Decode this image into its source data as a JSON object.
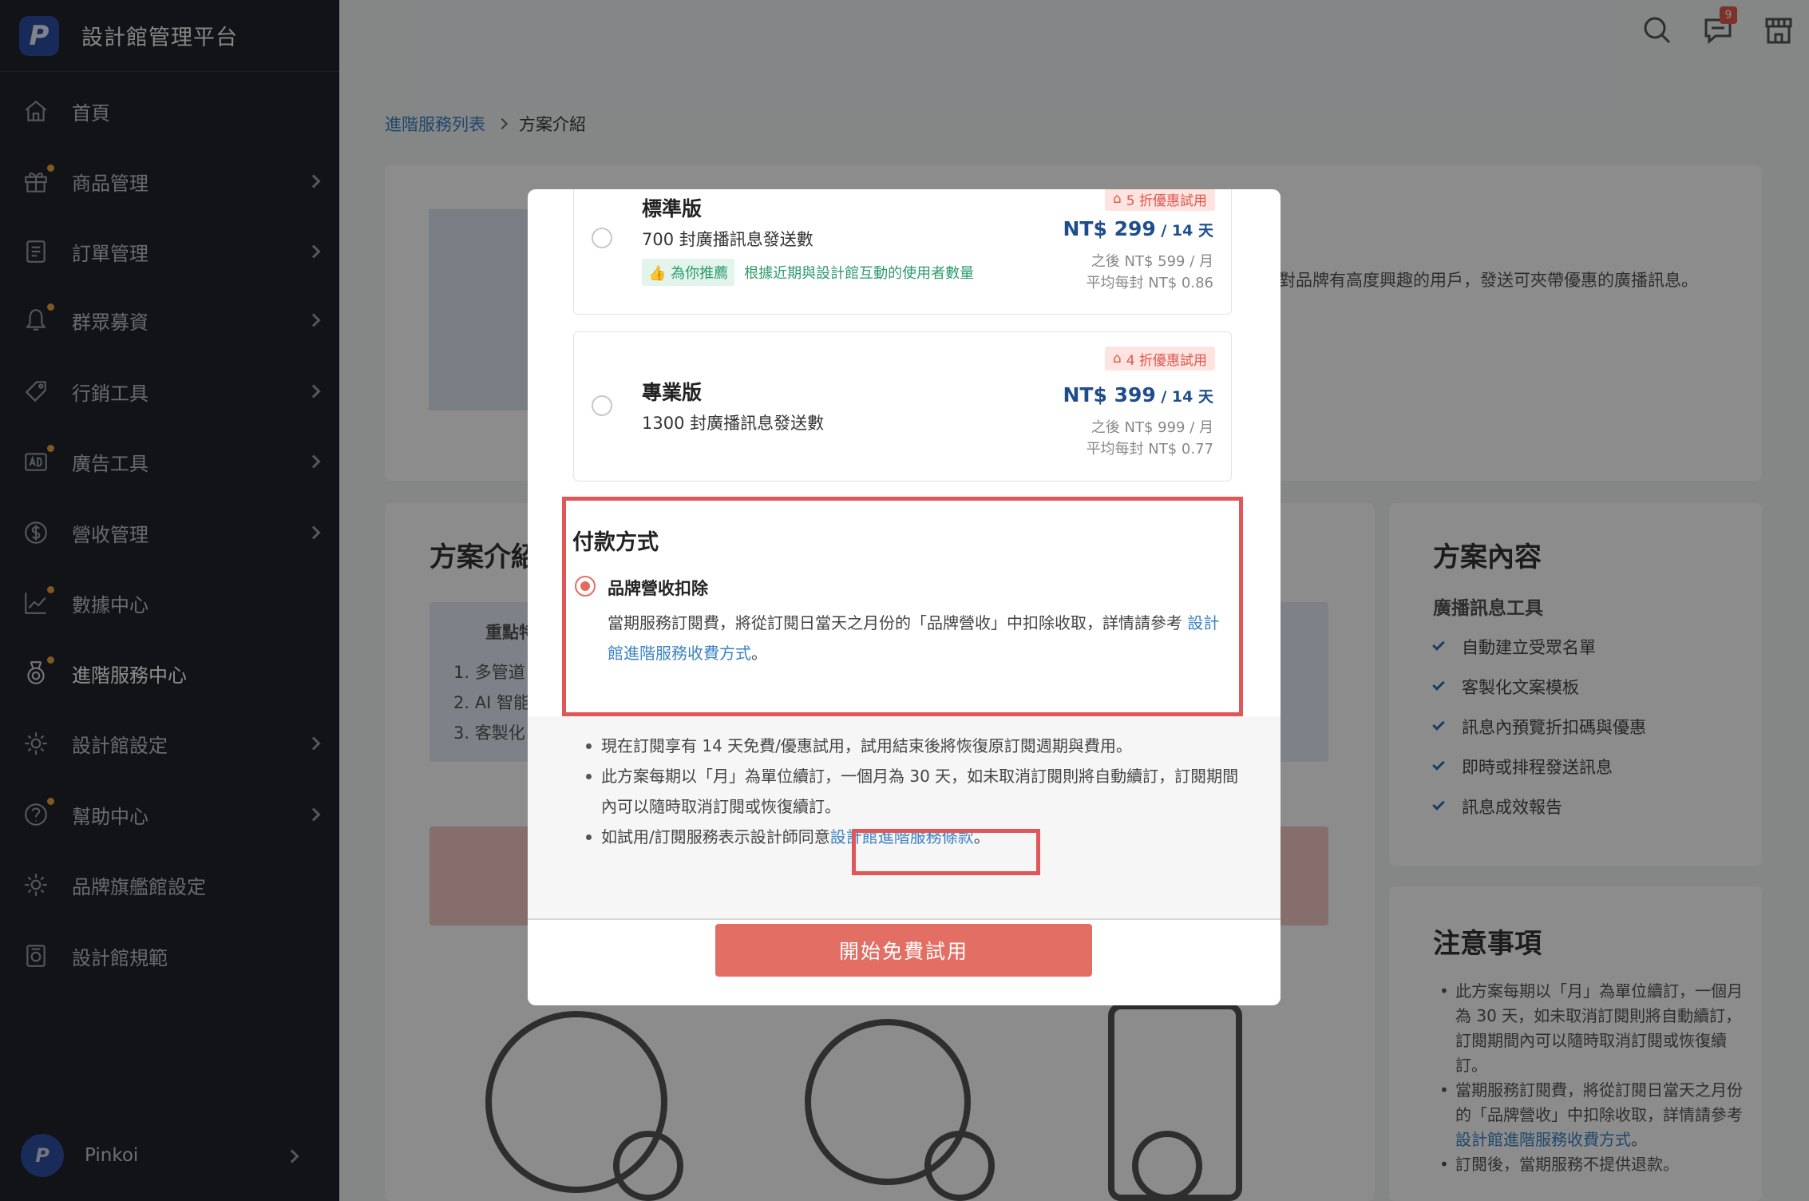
{
  "app": {
    "title": "設計館管理平台",
    "logo_letter": "P"
  },
  "sidebar": {
    "items": [
      {
        "label": "首頁",
        "icon": "home-icon"
      },
      {
        "label": "商品管理",
        "icon": "gift-icon"
      },
      {
        "label": "訂單管理",
        "icon": "receipt-icon"
      },
      {
        "label": "群眾募資",
        "icon": "crowdfunding-icon"
      },
      {
        "label": "行銷工具",
        "icon": "tag-icon"
      },
      {
        "label": "廣告工具",
        "icon": "ad-icon"
      },
      {
        "label": "營收管理",
        "icon": "dollar-icon"
      },
      {
        "label": "數據中心",
        "icon": "chart-icon"
      },
      {
        "label": "進階服務中心",
        "icon": "medal-icon"
      },
      {
        "label": "設計館設定",
        "icon": "gear-icon"
      },
      {
        "label": "幫助中心",
        "icon": "help-icon"
      },
      {
        "label": "品牌旗艦館設定",
        "icon": "gear-icon"
      },
      {
        "label": "設計館規範",
        "icon": "policy-icon"
      }
    ],
    "user": {
      "avatar_letter": "P",
      "name": "Pinkoi"
    }
  },
  "topbar": {
    "notification_count": "9"
  },
  "breadcrumb": {
    "parent": "進階服務列表",
    "current": "方案介紹"
  },
  "background": {
    "intro_text": "對品牌有高度興趣的用戶，發送可夾帶優惠的廣播訊息。",
    "intro_title": "方案介紹",
    "highlights_title": "重點特",
    "highlights": [
      "1. 多管道",
      "2. AI 智能",
      "3. 客製化"
    ],
    "content_title": "方案內容",
    "content_sub": "廣播訊息工具",
    "content_items": [
      "自動建立受眾名單",
      "客製化文案模板",
      "訊息內預覽折扣碼與優惠",
      "即時或排程發送訊息",
      "訊息成效報告"
    ],
    "notes_title": "注意事項",
    "notes": [
      "此方案每期以「月」為單位續訂，一個月為 30 天，如未取消訂閱則將自動續訂，訂閱期間內可以隨時取消訂閱或恢復續訂。",
      "當期服務訂閱費，將從訂閱日當天之月份的「品牌營收」中扣除收取，詳情請參考",
      "訂閱後，當期服務不提供退款。"
    ],
    "notes_link": "設計館進階服務收費方式",
    "notes_link_suffix": "。"
  },
  "modal": {
    "plans": [
      {
        "name": "標準版",
        "desc": "700 封廣播訊息發送數",
        "tag": "5 折優惠試用",
        "price": "NT$ 299",
        "period": " / 14 天",
        "after": "之後 NT$ 599 / 月",
        "per": "平均每封 NT$ 0.86",
        "rec_tag": "為你推薦",
        "rec_text": "根據近期與設計館互動的使用者數量"
      },
      {
        "name": "專業版",
        "desc": "1300 封廣播訊息發送數",
        "tag": "4 折優惠試用",
        "price": "NT$ 399",
        "period": " / 14 天",
        "after": "之後 NT$ 999 / 月",
        "per": "平均每封 NT$ 0.77"
      }
    ],
    "payment": {
      "title": "付款方式",
      "option": "品牌營收扣除",
      "desc_prefix": "當期服務訂閱費，將從訂閱日當天之月份的「品牌營收」中扣除收取，詳情請參考",
      "desc_link": "設計館進階服務收費方式",
      "desc_suffix": "。"
    },
    "notes": {
      "n1": "現在訂閱享有 14 天免費/優惠試用，試用結束後將恢復原訂閱週期與費用。",
      "n2": "此方案每期以「月」為單位續訂，一個月為 30 天，如未取消訂閱則將自動續訂，訂閱期間內可以隨時取消訂閱或恢復續訂。",
      "n3_prefix": "如試用/訂閱服務表示設計師同意",
      "n3_link": "設計館進階服務條款",
      "n3_suffix": "。"
    },
    "cta": "開始免費試用"
  }
}
